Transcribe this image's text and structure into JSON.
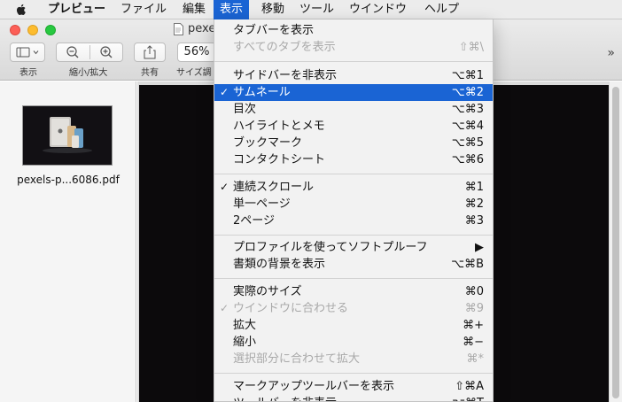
{
  "menubar": {
    "app_name": "プレビュー",
    "items": [
      "ファイル",
      "編集",
      "表示",
      "移動",
      "ツール",
      "ウインドウ",
      "ヘルプ"
    ]
  },
  "window": {
    "title": "pexe",
    "toolbar": {
      "sidebar_label": "表示",
      "zoom_label": "縮小/拡大",
      "share_label": "共有",
      "size_label": "サイズ調",
      "zoom_value": "56%",
      "overflow": "»"
    }
  },
  "sidebar": {
    "thumbnail_caption": "pexels-p...6086.pdf"
  },
  "view_menu": {
    "items": [
      {
        "label": "タブバーを表示",
        "shortcut": "",
        "checked": false,
        "disabled": false,
        "highlighted": false
      },
      {
        "label": "すべてのタブを表示",
        "shortcut": "⇧⌘\\",
        "checked": false,
        "disabled": true,
        "highlighted": false
      },
      {
        "label": "サイドバーを非表示",
        "shortcut": "⌥⌘1",
        "checked": false,
        "disabled": false,
        "highlighted": false
      },
      {
        "label": "サムネール",
        "shortcut": "⌥⌘2",
        "checked": true,
        "disabled": false,
        "highlighted": true
      },
      {
        "label": "目次",
        "shortcut": "⌥⌘3",
        "checked": false,
        "disabled": false,
        "highlighted": false
      },
      {
        "label": "ハイライトとメモ",
        "shortcut": "⌥⌘4",
        "checked": false,
        "disabled": false,
        "highlighted": false
      },
      {
        "label": "ブックマーク",
        "shortcut": "⌥⌘5",
        "checked": false,
        "disabled": false,
        "highlighted": false
      },
      {
        "label": "コンタクトシート",
        "shortcut": "⌥⌘6",
        "checked": false,
        "disabled": false,
        "highlighted": false
      },
      {
        "label": "連続スクロール",
        "shortcut": "⌘1",
        "checked": true,
        "disabled": false,
        "highlighted": false
      },
      {
        "label": "単一ページ",
        "shortcut": "⌘2",
        "checked": false,
        "disabled": false,
        "highlighted": false
      },
      {
        "label": "2ページ",
        "shortcut": "⌘3",
        "checked": false,
        "disabled": false,
        "highlighted": false
      },
      {
        "label": "プロファイルを使ってソフトプルーフ",
        "shortcut": "▶",
        "checked": false,
        "disabled": false,
        "highlighted": false
      },
      {
        "label": "書類の背景を表示",
        "shortcut": "⌥⌘B",
        "checked": false,
        "disabled": false,
        "highlighted": false
      },
      {
        "label": "実際のサイズ",
        "shortcut": "⌘0",
        "checked": false,
        "disabled": false,
        "highlighted": false
      },
      {
        "label": "ウインドウに合わせる",
        "shortcut": "⌘9",
        "checked": true,
        "disabled": true,
        "highlighted": false
      },
      {
        "label": "拡大",
        "shortcut": "⌘+",
        "checked": false,
        "disabled": false,
        "highlighted": false
      },
      {
        "label": "縮小",
        "shortcut": "⌘−",
        "checked": false,
        "disabled": false,
        "highlighted": false
      },
      {
        "label": "選択部分に合わせて拡大",
        "shortcut": "⌘*",
        "checked": false,
        "disabled": true,
        "highlighted": false
      },
      {
        "label": "マークアップツールバーを表示",
        "shortcut": "⇧⌘A",
        "checked": false,
        "disabled": false,
        "highlighted": false
      },
      {
        "label": "ツールバーを非表示",
        "shortcut": "⌥⌘T",
        "checked": false,
        "disabled": false,
        "highlighted": false
      }
    ]
  },
  "colors": {
    "highlight": "#1a64d4",
    "disabled_text": "#a9a9a9"
  }
}
